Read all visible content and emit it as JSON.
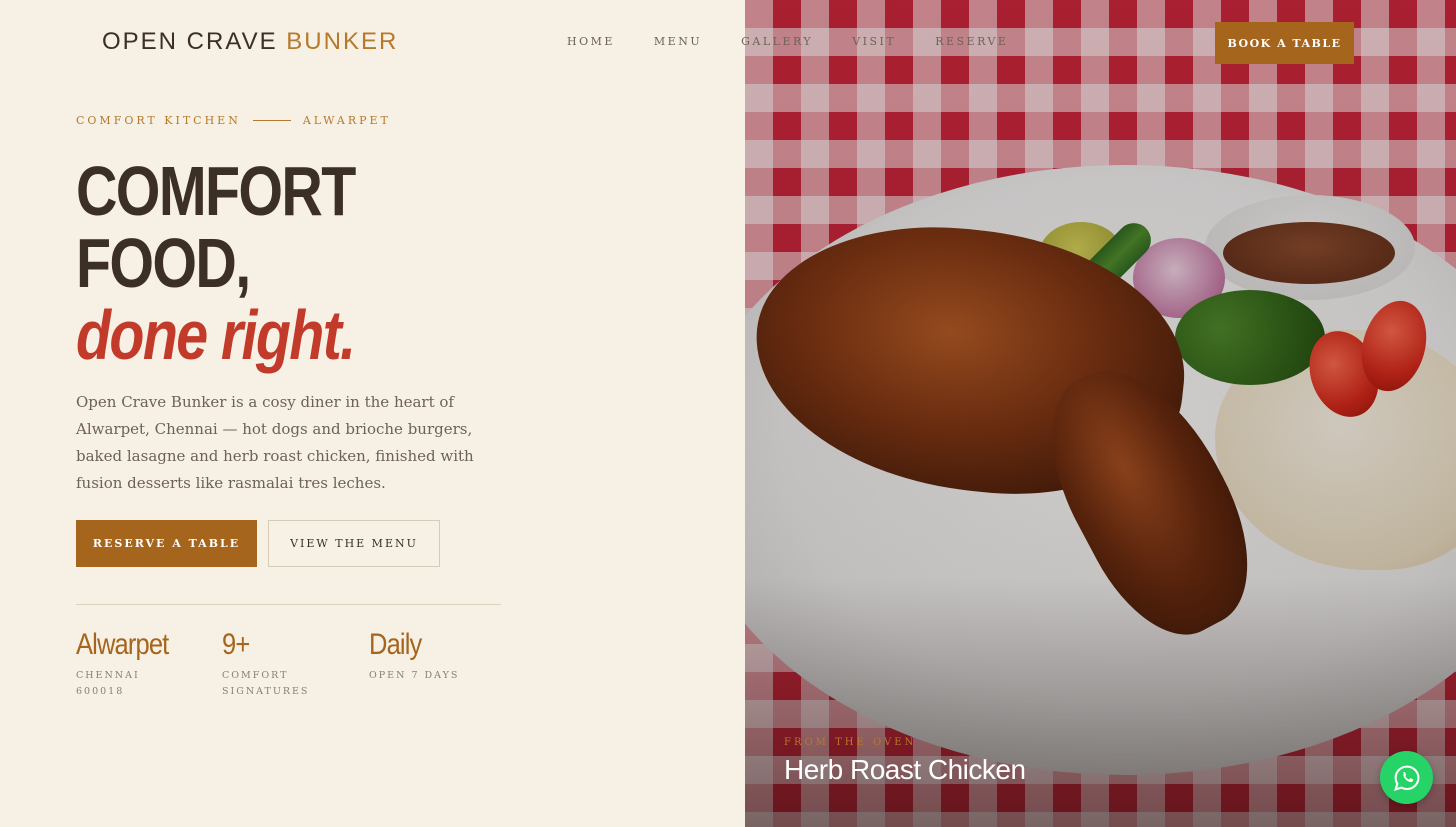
{
  "header": {
    "logo_main": "OPEN CRAVE ",
    "logo_accent": "BUNKER",
    "nav": [
      "HOME",
      "MENU",
      "GALLERY",
      "VISIT",
      "RESERVE"
    ],
    "book_label": "BOOK A TABLE"
  },
  "hero": {
    "kicker_left": "COMFORT KITCHEN",
    "kicker_right": "ALWARPET",
    "headline_line1": "COMFORT",
    "headline_line2": "FOOD,",
    "headline_accent": "done right.",
    "description": "Open Crave Bunker is a cosy diner in the heart of Alwarpet, Chennai — hot dogs and brioche burgers, baked lasagne and herb roast chicken, finished with fusion desserts like rasmalai tres leches.",
    "primary_button": "RESERVE A TABLE",
    "secondary_button": "VIEW THE MENU"
  },
  "stats": [
    {
      "value": "Alwarpet",
      "label": "CHENNAI 600018"
    },
    {
      "value": "9+",
      "label": "COMFORT SIGNATURES"
    },
    {
      "value": "Daily",
      "label": "OPEN 7 DAYS"
    }
  ],
  "feature": {
    "kicker": "FROM THE OVEN",
    "title": "Herb Roast Chicken"
  },
  "colors": {
    "accent": "#a5651d",
    "accent_red": "#c23b2a",
    "background": "#f7f0e4",
    "whatsapp": "#25d366"
  },
  "icons": {
    "whatsapp": "whatsapp-icon"
  }
}
